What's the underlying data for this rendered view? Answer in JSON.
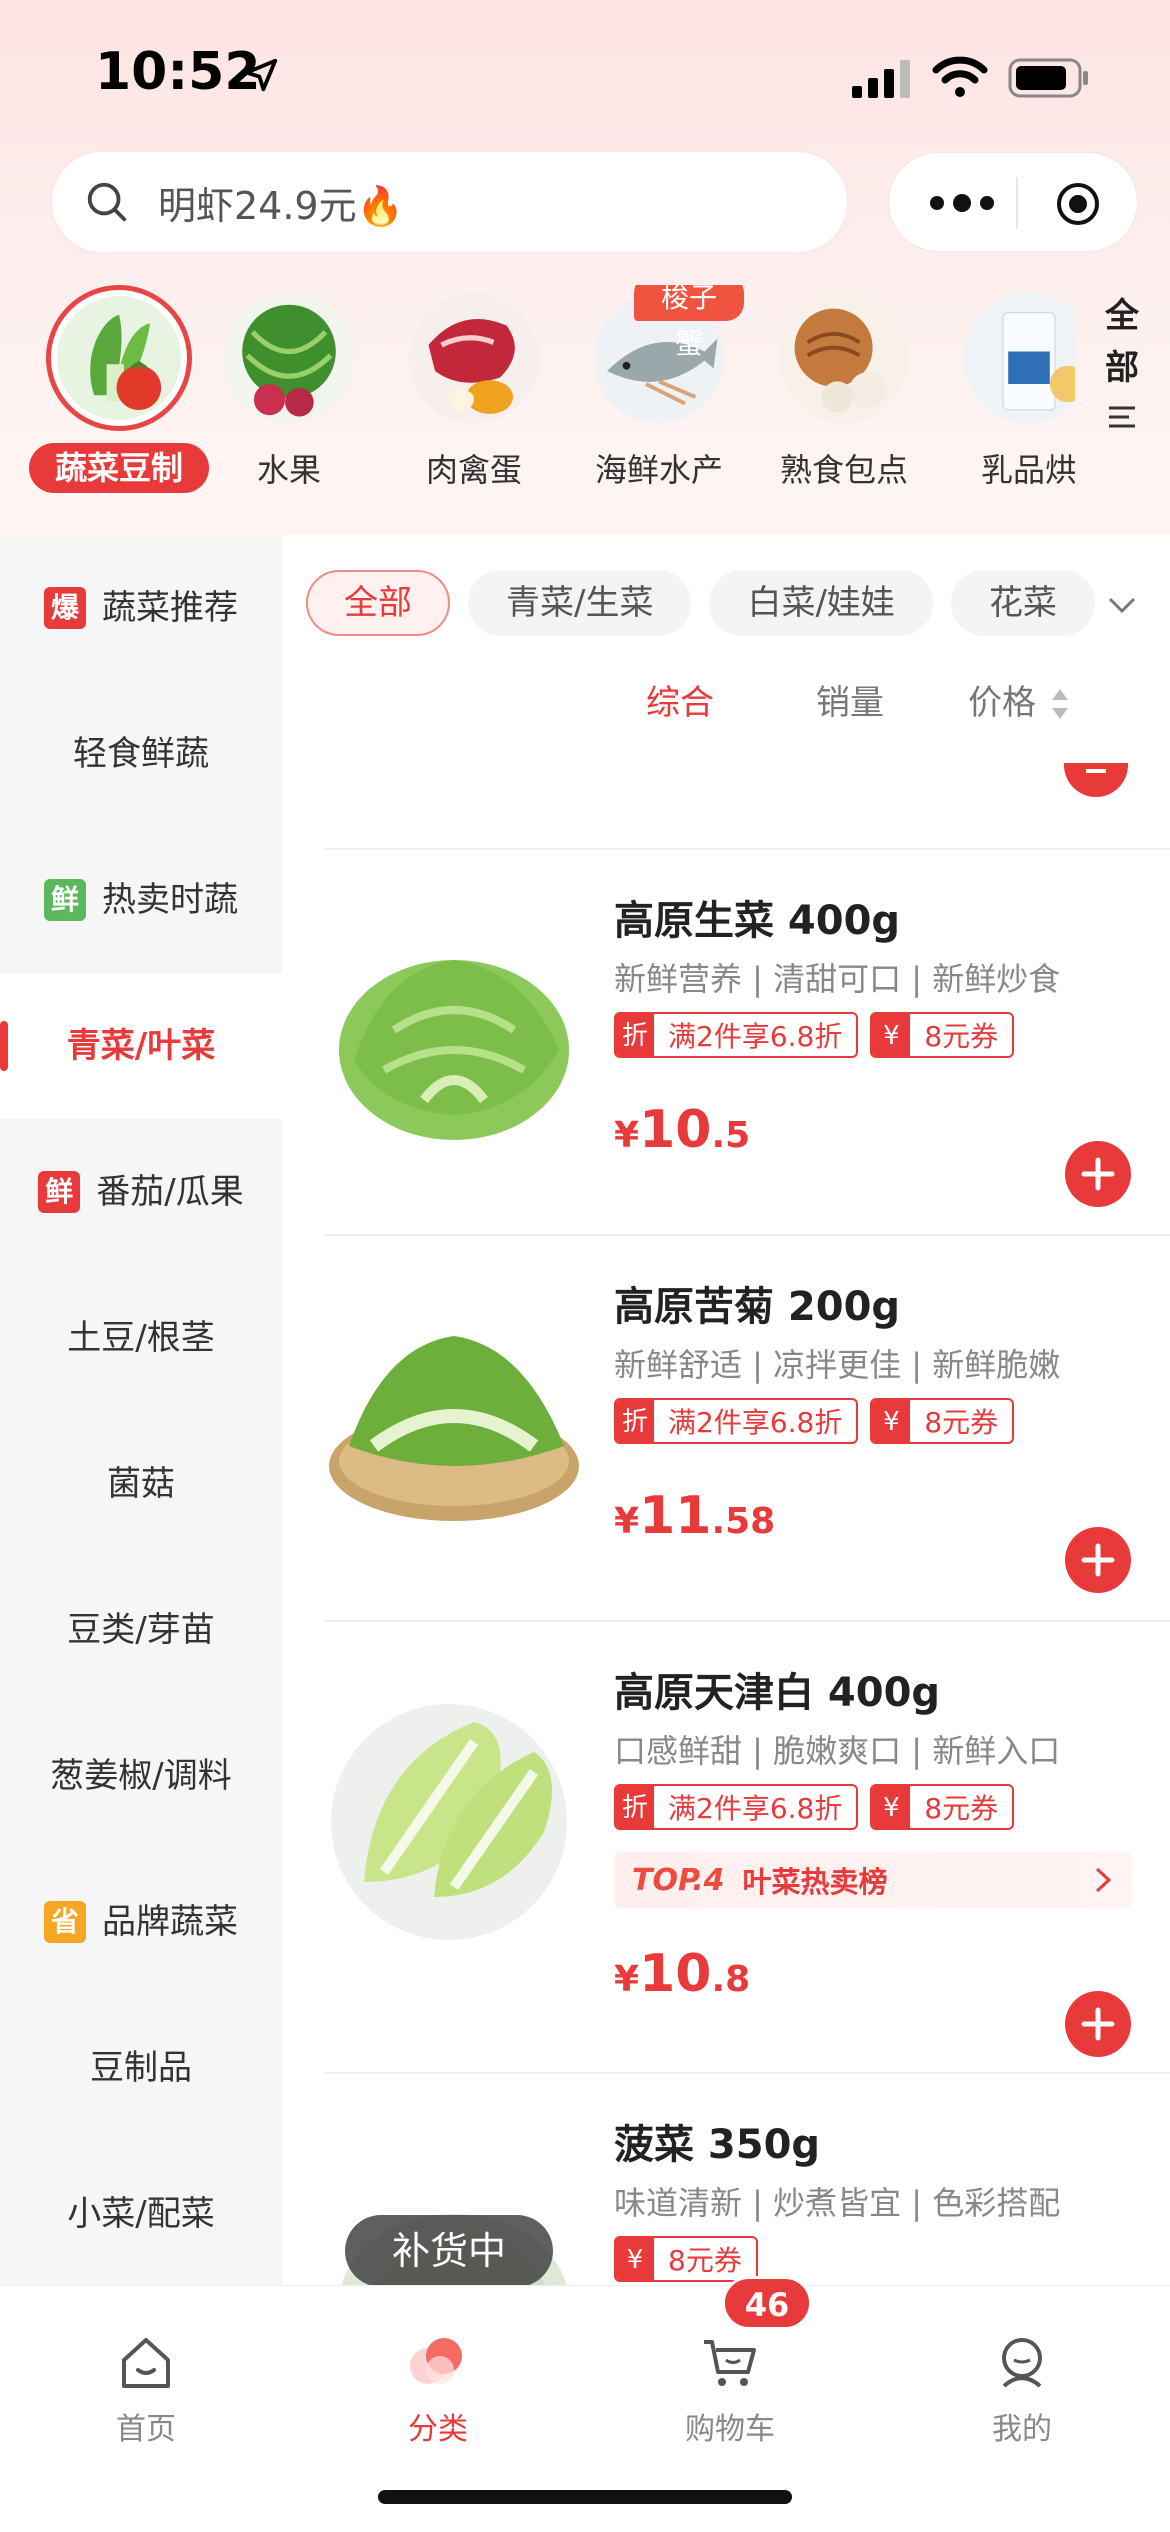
{
  "status_bar": {
    "time": "10:52"
  },
  "search": {
    "placeholder": "明虾24.9元🔥"
  },
  "categories": [
    {
      "label": "蔬菜豆制",
      "active": true
    },
    {
      "label": "水果"
    },
    {
      "label": "肉禽蛋"
    },
    {
      "label": "海鲜水产",
      "badge": "梭子蟹"
    },
    {
      "label": "熟食包点"
    },
    {
      "label": "乳品烘"
    }
  ],
  "all_button": {
    "line1": "全",
    "line2": "部"
  },
  "sidebar": {
    "items": [
      {
        "label": "蔬菜推荐",
        "tag": "爆",
        "tag_color": "#e83a3a"
      },
      {
        "label": "轻食鲜蔬"
      },
      {
        "label": "热卖时蔬",
        "tag": "鲜",
        "tag_color": "#5cb85c"
      },
      {
        "label": "青菜/叶菜",
        "active": true
      },
      {
        "label": "番茄/瓜果",
        "tag": "鲜",
        "tag_color": "#e83a3a"
      },
      {
        "label": "土豆/根茎"
      },
      {
        "label": "菌菇"
      },
      {
        "label": "豆类/芽苗"
      },
      {
        "label": "葱姜椒/调料"
      },
      {
        "label": "品牌蔬菜",
        "tag": "省",
        "tag_color": "#f5a623"
      },
      {
        "label": "豆制品"
      },
      {
        "label": "小菜/配菜"
      }
    ]
  },
  "filters": [
    "全部",
    "青菜/生菜",
    "白菜/娃娃",
    "花菜"
  ],
  "sort": {
    "comprehensive": "综合",
    "sales": "销量",
    "price": "价格"
  },
  "products": [
    {
      "name": "高原生菜 400g",
      "subtitle": "新鲜营养 | 清甜可口 | 新鲜炒食",
      "coupons": [
        {
          "icon": "折",
          "text": "满2件享6.8折"
        },
        {
          "icon": "¥",
          "text": "8元券"
        }
      ],
      "price_currency": "¥",
      "price_int": "10",
      "price_dec": ".5"
    },
    {
      "name": "高原苦菊 200g",
      "subtitle": "新鲜舒适 | 凉拌更佳 | 新鲜脆嫩",
      "coupons": [
        {
          "icon": "折",
          "text": "满2件享6.8折"
        },
        {
          "icon": "¥",
          "text": "8元券"
        }
      ],
      "price_currency": "¥",
      "price_int": "11",
      "price_dec": ".58"
    },
    {
      "name": "高原天津白 400g",
      "subtitle": "口感鲜甜 | 脆嫩爽口 | 新鲜入口",
      "coupons": [
        {
          "icon": "折",
          "text": "满2件享6.8折"
        },
        {
          "icon": "¥",
          "text": "8元券"
        }
      ],
      "rank": {
        "top": "TOP.4",
        "text": "叶菜热卖榜"
      },
      "price_currency": "¥",
      "price_int": "10",
      "price_dec": ".8"
    },
    {
      "name": "菠菜 350g",
      "subtitle": "味道清新 | 炒煮皆宜 | 色彩搭配",
      "coupons": [
        {
          "icon": "¥",
          "text": "8元券"
        }
      ]
    }
  ],
  "restock_label": "补货中",
  "tabbar": {
    "items": [
      {
        "label": "首页"
      },
      {
        "label": "分类",
        "active": true
      },
      {
        "label": "购物车"
      },
      {
        "label": "我的"
      }
    ],
    "cart_count": "46"
  },
  "colors": {
    "accent": "#e83a3a",
    "green_tag": "#5cb85c",
    "orange_tag": "#f5a623"
  }
}
